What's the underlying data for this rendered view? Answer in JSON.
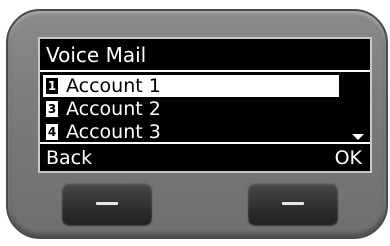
{
  "screen": {
    "title": "Voice Mail",
    "items": [
      {
        "number": "1",
        "label": "Account 1",
        "selected": true
      },
      {
        "number": "3",
        "label": "Account 2",
        "selected": false
      },
      {
        "number": "4",
        "label": "Account 3",
        "selected": false
      }
    ],
    "more_indicator": "scroll-down-arrow-icon",
    "softkeys": {
      "left": "Back",
      "right": "OK"
    }
  },
  "colors": {
    "screen_background": "#000000",
    "screen_text": "#ffffff",
    "device_body": "#7c7c7c",
    "hardware_button": "#2e2e2e"
  }
}
